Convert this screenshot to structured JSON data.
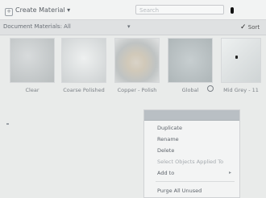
{
  "toolbar": {
    "create_label": "Create Material",
    "create_chevron": "▾",
    "search_placeholder": "Search"
  },
  "filter": {
    "label": "Document Materials: All",
    "chevron": "▾"
  },
  "sort": {
    "check_icon": "✓",
    "label": "Sort"
  },
  "materials": [
    {
      "name": "Clear",
      "icon": "glass-swatch"
    },
    {
      "name": "Coarse Polished",
      "icon": "stone-swatch"
    },
    {
      "name": "Copper - Polish",
      "icon": "copper-sphere-swatch"
    },
    {
      "name": "Global",
      "icon": "global-swatch"
    },
    {
      "name": "Mid Grey - 11",
      "icon": "grey-swatch"
    }
  ],
  "context_menu": {
    "header": "",
    "items": [
      {
        "label": "Duplicate",
        "enabled": true
      },
      {
        "label": "Rename",
        "enabled": true
      },
      {
        "label": "Delete",
        "enabled": true
      },
      {
        "label": "Select Objects Applied To",
        "enabled": false
      },
      {
        "label": "Add to",
        "enabled": true,
        "submenu": true
      },
      {
        "label": "Purge All Unused",
        "enabled": true
      }
    ]
  }
}
